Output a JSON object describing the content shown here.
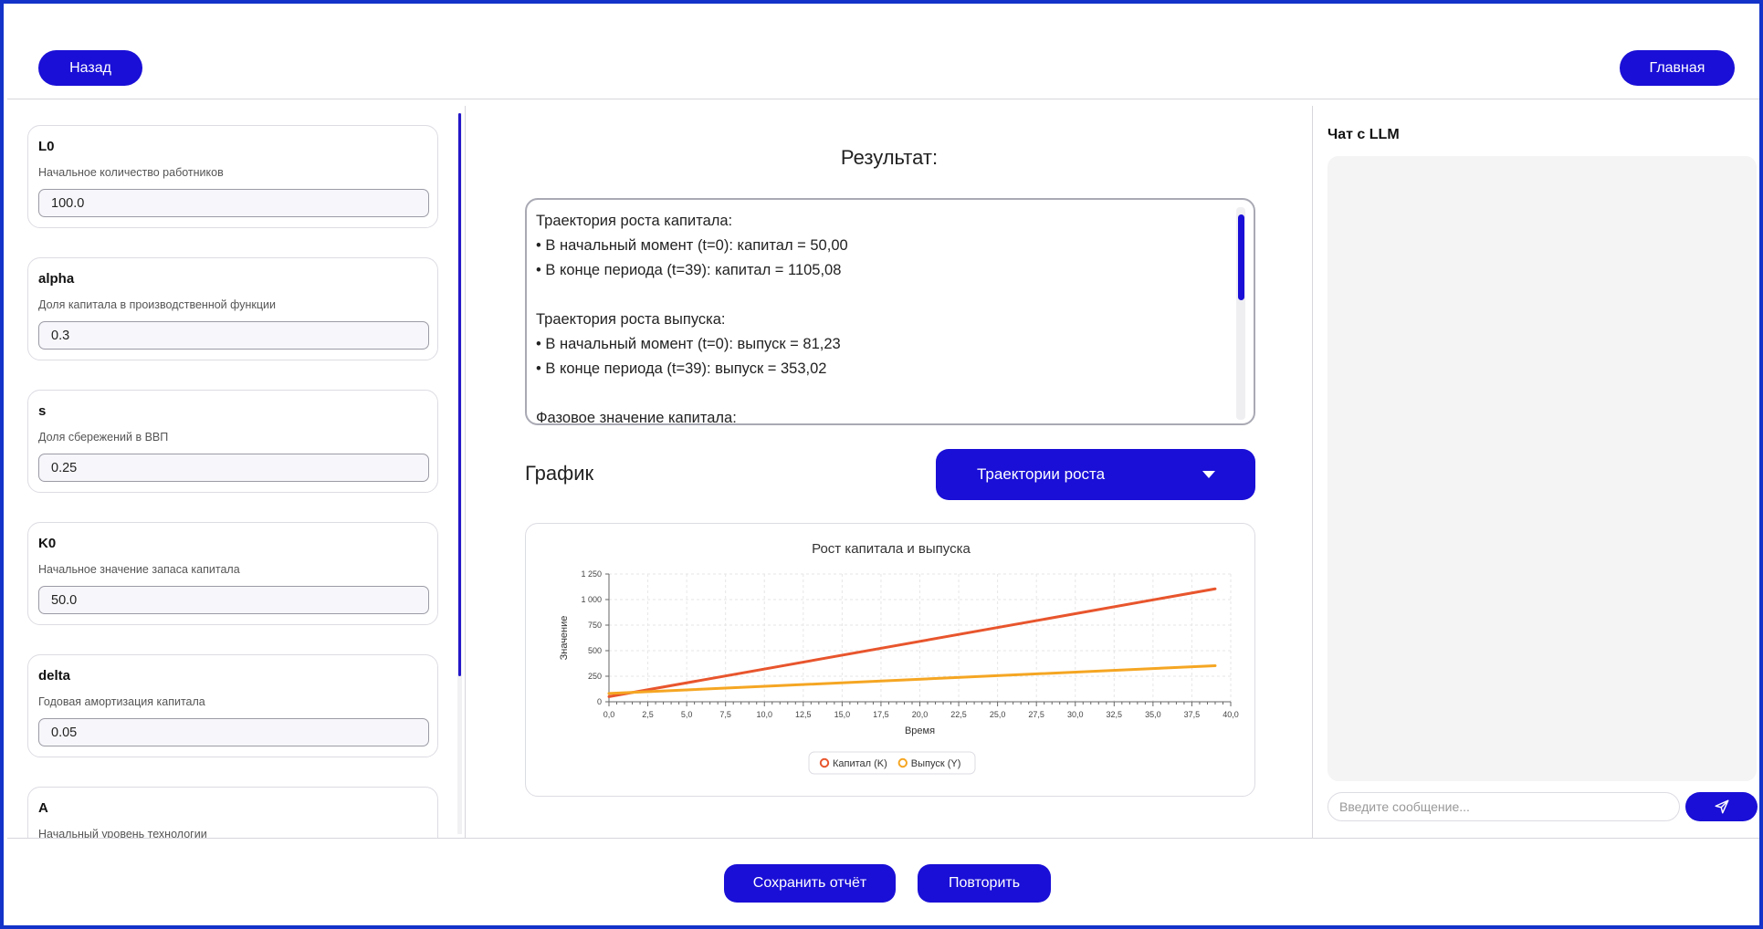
{
  "header": {
    "back_label": "Назад",
    "home_label": "Главная"
  },
  "params": [
    {
      "name": "L0",
      "description": "Начальное количество работников",
      "value": "100.0"
    },
    {
      "name": "alpha",
      "description": "Доля капитала в производственной функции",
      "value": "0.3"
    },
    {
      "name": "s",
      "description": "Доля сбережений в ВВП",
      "value": "0.25"
    },
    {
      "name": "K0",
      "description": "Начальное значение запаса капитала",
      "value": "50.0"
    },
    {
      "name": "delta",
      "description": "Годовая амортизация капитала",
      "value": "0.05"
    },
    {
      "name": "A",
      "description": "Начальный уровень технологии",
      "value": ""
    }
  ],
  "result": {
    "title": "Результат:",
    "text": "Траектория роста капитала:\n• В начальный момент (t=0): капитал = 50,00\n• В конце периода (t=39): капитал = 1105,08\n\nТраектория роста выпуска:\n• В начальный момент (t=0): выпуск = 81,23\n• В конце периода (t=39): выпуск = 353,02\n\nФазовое значение капитала:"
  },
  "graph": {
    "label": "График",
    "selected_option": "Траектории роста"
  },
  "chart_data": {
    "type": "line",
    "title": "Рост капитала и выпуска",
    "xlabel": "Время",
    "ylabel": "Значение",
    "xlim": [
      0,
      40
    ],
    "ylim": [
      0,
      1250
    ],
    "x_ticks": [
      "0,0",
      "2,5",
      "5,0",
      "7,5",
      "10,0",
      "12,5",
      "15,0",
      "17,5",
      "20,0",
      "22,5",
      "25,0",
      "27,5",
      "30,0",
      "32,5",
      "35,0",
      "37,5",
      "40,0"
    ],
    "y_ticks": [
      "0",
      "250",
      "500",
      "750",
      "1 000",
      "1 250"
    ],
    "grid": true,
    "legend_position": "bottom",
    "series": [
      {
        "name": "Капитал (K)",
        "color": "#e8552d",
        "x": [
          0,
          39
        ],
        "y": [
          50,
          1105.08
        ]
      },
      {
        "name": "Выпуск (Y)",
        "color": "#f5a623",
        "x": [
          0,
          39
        ],
        "y": [
          81.23,
          353.02
        ]
      }
    ]
  },
  "chat": {
    "title": "Чат с LLM",
    "placeholder": "Введите сообщение..."
  },
  "footer": {
    "save_label": "Сохранить отчёт",
    "repeat_label": "Повторить"
  },
  "colors": {
    "primary": "#1a0fd6",
    "frame": "#1433c9"
  }
}
